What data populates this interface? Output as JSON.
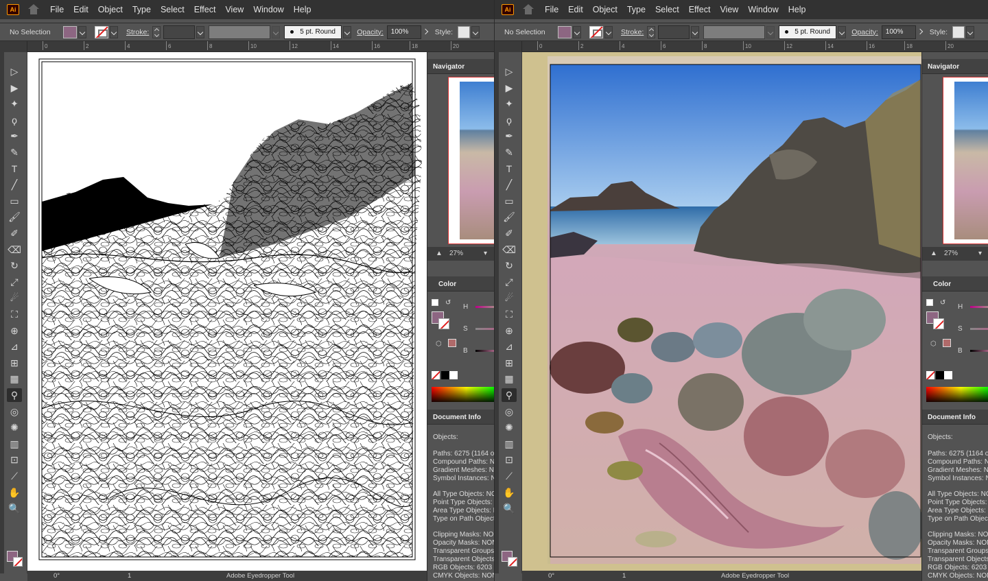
{
  "app": {
    "logo": "Ai"
  },
  "menu": [
    "File",
    "Edit",
    "Object",
    "Type",
    "Select",
    "Effect",
    "View",
    "Window",
    "Help"
  ],
  "control": {
    "selection": "No Selection",
    "stroke_label": "Stroke:",
    "brush": "5 pt. Round",
    "opacity_label": "Opacity:",
    "opacity_value": "100%",
    "style_label": "Style:",
    "fill_color": "#8d6682",
    "stroke_color": "none"
  },
  "rulers": [
    "0",
    "2",
    "4",
    "6",
    "8",
    "10",
    "12",
    "14",
    "16",
    "18",
    "20"
  ],
  "panels": {
    "navigator": {
      "title": "Navigator",
      "zoom": "27%"
    },
    "color": {
      "title": "Color",
      "h": "H",
      "s": "S",
      "b": "B"
    },
    "docinfo": {
      "title": "Document Info",
      "objects": "Objects:",
      "lines": [
        "Paths: 6275 (1164 o",
        "Compound Paths: NO",
        "Gradient Meshes: NO",
        "Symbol Instances: NO",
        "All Type Objects: NO",
        "Point Type Objects: I",
        "Area Type Objects: N",
        "Type on Path Object",
        "Clipping Masks: NON",
        "Opacity Masks: NON",
        "Transparent Groups:",
        "Transparent Objects:",
        "RGB Objects: 6203",
        "CMYK Objects: NON"
      ]
    }
  },
  "status": {
    "rotation": "0°",
    "artboard": "1",
    "tool": "Adobe Eyedropper Tool"
  },
  "tool_icons": [
    "selection-icon",
    "direct-selection-icon",
    "magic-wand-icon",
    "lasso-icon",
    "pen-icon",
    "curvature-icon",
    "type-icon",
    "line-segment-icon",
    "rectangle-icon",
    "paintbrush-icon",
    "shaper-icon",
    "eraser-icon",
    "rotate-icon",
    "scale-icon",
    "warp-icon",
    "free-transform-icon",
    "shape-builder-icon",
    "perspective-grid-icon",
    "mesh-icon",
    "gradient-icon",
    "eyedropper-icon",
    "blend-icon",
    "symbol-sprayer-icon",
    "column-graph-icon",
    "artboard-icon",
    "slice-icon",
    "hand-icon",
    "zoom-icon"
  ]
}
